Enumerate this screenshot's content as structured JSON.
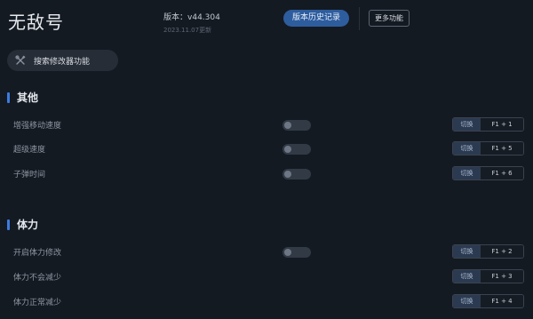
{
  "app": {
    "title": "无敌号"
  },
  "header": {
    "version_label": "版本：",
    "version": "v44.304",
    "date": "2023.11.07更新",
    "history_button": "版本历史记录",
    "more_button": "更多功能"
  },
  "search": {
    "label": "搜索修改器功能",
    "icon": "tools-icon"
  },
  "sections": [
    {
      "title": "其他",
      "items": [
        {
          "label": "增强移动速度",
          "toggle": true,
          "enabled": false,
          "switch_label": "切换",
          "hotkey": "F1 + 1"
        },
        {
          "label": "超级速度",
          "toggle": true,
          "enabled": false,
          "switch_label": "切换",
          "hotkey": "F1 + 5"
        },
        {
          "label": "子弹时间",
          "toggle": true,
          "enabled": false,
          "switch_label": "切换",
          "hotkey": "F1 + 6"
        }
      ]
    },
    {
      "title": "体力",
      "items": [
        {
          "label": "开启体力修改",
          "toggle": true,
          "enabled": false,
          "switch_label": "切换",
          "hotkey": "F1 + 2"
        },
        {
          "label": "体力不会减少",
          "toggle": false,
          "switch_label": "切换",
          "hotkey": "F1 + 3"
        },
        {
          "label": "体力正常减少",
          "toggle": false,
          "switch_label": "切换",
          "hotkey": "F1 + 4"
        }
      ]
    }
  ],
  "colors": {
    "accent": "#3d7be0",
    "background": "#141a22",
    "button": "#2e5d9e"
  }
}
